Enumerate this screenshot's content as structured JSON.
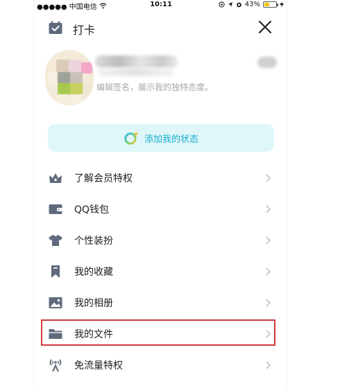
{
  "status_bar": {
    "carrier": "●●●●● 中国电信",
    "time": "10:11",
    "battery_pct": "43%",
    "battery_level": 0.43,
    "icons": [
      "wifi-icon",
      "location-icon",
      "alarm-icon",
      "battery-icon",
      "charging-icon"
    ]
  },
  "header": {
    "checkin_label": "打卡",
    "close_icon": "close-icon"
  },
  "profile": {
    "signature_placeholder": "编辑签名，展示我的独特态度。"
  },
  "status_button": {
    "label": "添加我的状态"
  },
  "menu": {
    "items": [
      {
        "label": "了解会员特权",
        "icon": "crown-icon"
      },
      {
        "label": "QQ钱包",
        "icon": "wallet-icon"
      },
      {
        "label": "个性装扮",
        "icon": "shirt-icon"
      },
      {
        "label": "我的收藏",
        "icon": "bookmark-icon"
      },
      {
        "label": "我的相册",
        "icon": "photo-icon"
      },
      {
        "label": "我的文件",
        "icon": "folder-icon",
        "highlighted": true
      },
      {
        "label": "免流量特权",
        "icon": "signal-tower-icon"
      }
    ]
  },
  "colors": {
    "icon_gray": "#5f6a7d",
    "accent": "#14aecb",
    "status_bg": "#e0f7fa",
    "highlight_border": "#d0393c"
  }
}
